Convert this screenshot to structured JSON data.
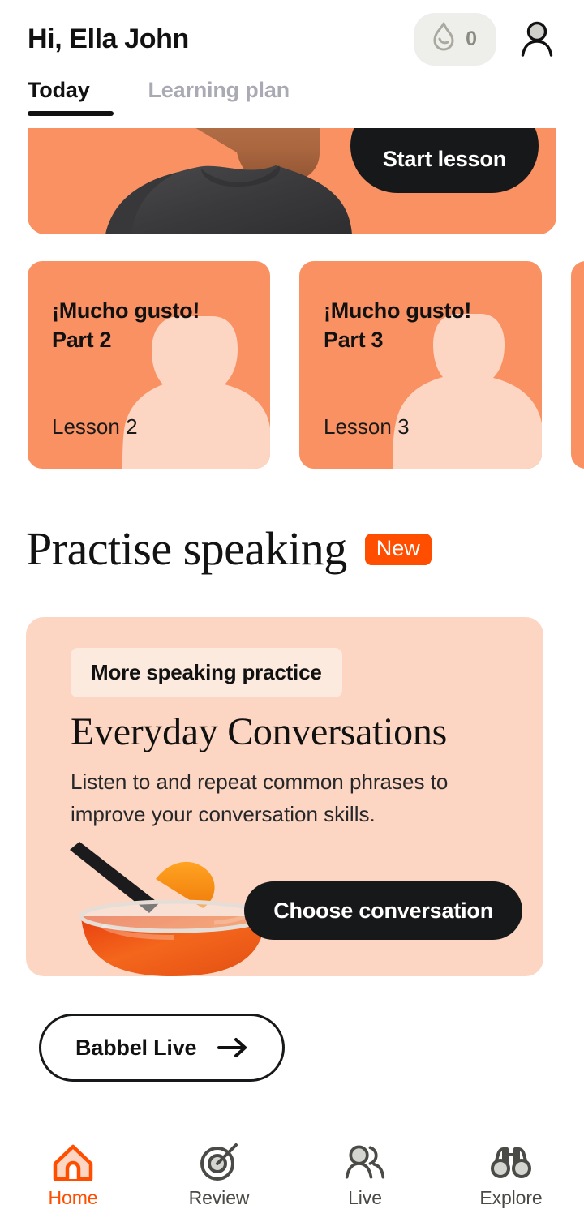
{
  "header": {
    "greeting": "Hi, Ella John",
    "streak_count": "0",
    "streak_icon": "flame-icon",
    "avatar_icon": "person-icon"
  },
  "tabs": [
    {
      "label": "Today",
      "active": true
    },
    {
      "label": "Learning plan",
      "active": false
    }
  ],
  "hero": {
    "button_label": "Start lesson",
    "background_color": "#f99163",
    "image_alt": "man-in-dark-tshirt-photo"
  },
  "lesson_cards": [
    {
      "title": "¡Mucho gusto!\nPart 2",
      "subtitle": "Lesson 2"
    },
    {
      "title": "¡Mucho gusto!\nPart 3",
      "subtitle": "Lesson 3"
    },
    {
      "title": "",
      "subtitle": ""
    }
  ],
  "practise_section": {
    "title": "Practise speaking",
    "badge": "New",
    "badge_color": "#ff4e00"
  },
  "practice_card": {
    "chip": "More speaking practice",
    "title": "Everyday Conversations",
    "description": "Listen to and repeat common phrases to improve your conversation skills.",
    "button_label": "Choose conversation",
    "background_color": "#fcd6c2",
    "image_alt": "aperol-spritz-cocktail-photo"
  },
  "live_button": {
    "label": "Babbel Live",
    "icon": "arrow-right-icon"
  },
  "bottom_nav": [
    {
      "label": "Home",
      "icon": "home-icon",
      "active": true
    },
    {
      "label": "Review",
      "icon": "target-icon",
      "active": false
    },
    {
      "label": "Live",
      "icon": "people-icon",
      "active": false
    },
    {
      "label": "Explore",
      "icon": "binoculars-icon",
      "active": false
    }
  ],
  "colors": {
    "accent": "#ff4e00",
    "card_orange": "#f99163",
    "card_peach": "#fcd6c2",
    "dark": "#17181a"
  }
}
